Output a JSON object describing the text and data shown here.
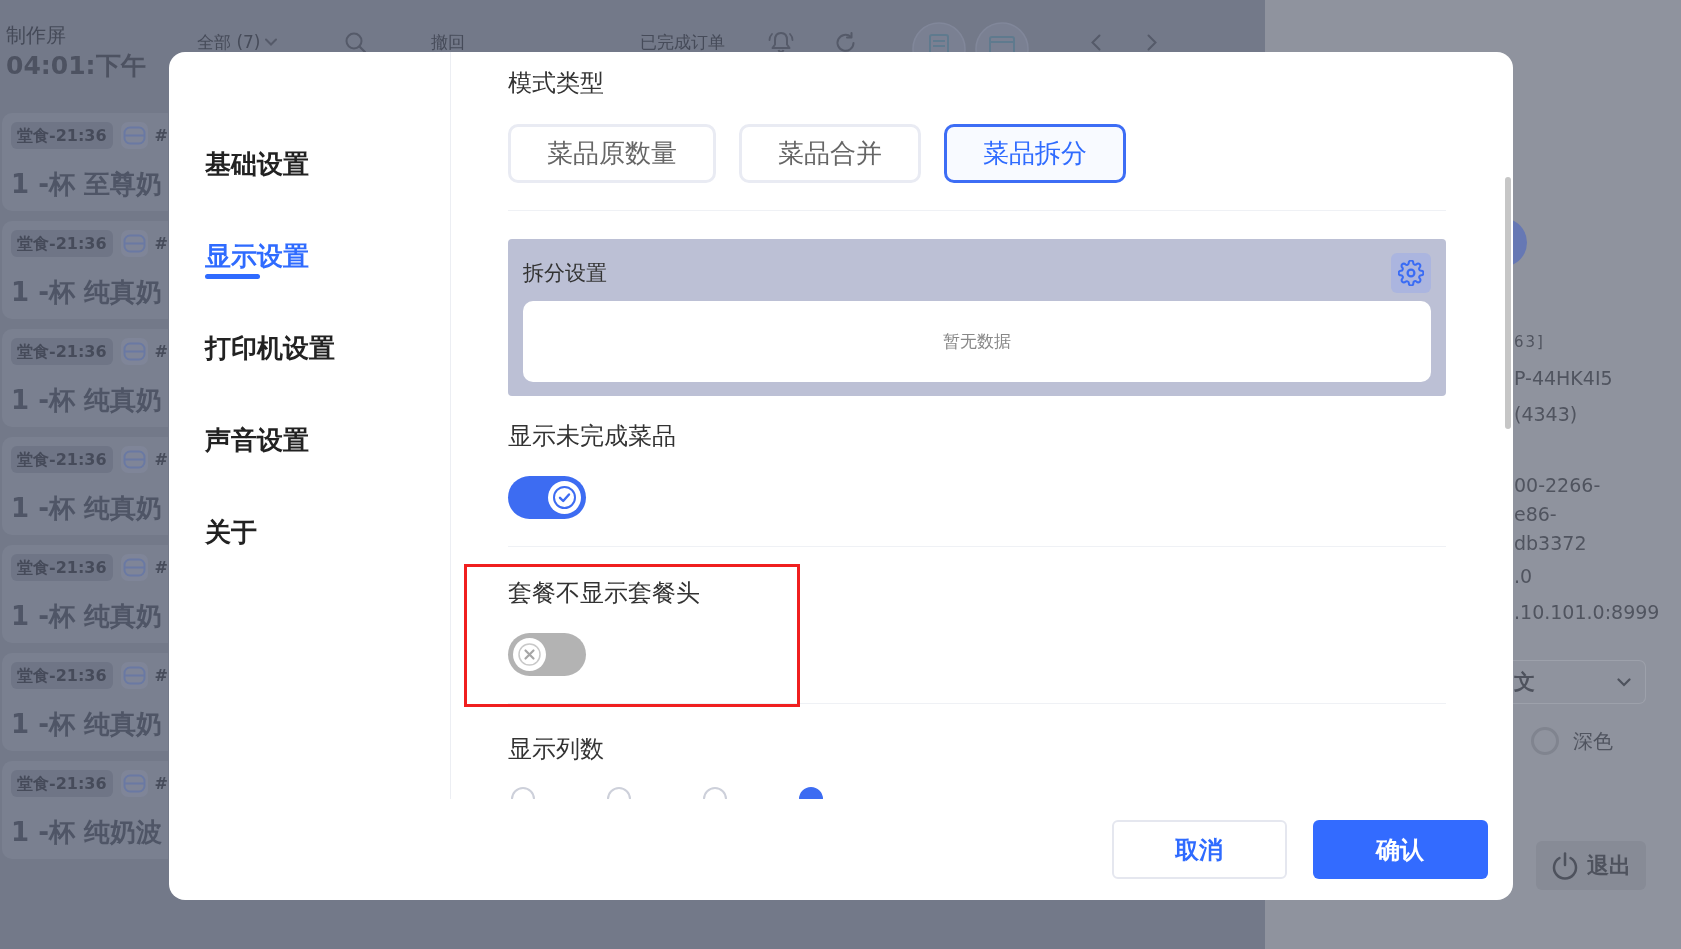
{
  "header": {
    "title": "制作屏",
    "time": "04:01:下午",
    "filter": "全部 (7)",
    "actions": [
      "撤回",
      "已完成订单"
    ]
  },
  "orders": [
    {
      "tag": "堂食-21:36",
      "number": "#",
      "item": "1 -杯 至尊奶"
    },
    {
      "tag": "堂食-21:36",
      "number": "#",
      "item": "1 -杯 纯真奶"
    },
    {
      "tag": "堂食-21:36",
      "number": "#",
      "item": "1 -杯 纯真奶"
    },
    {
      "tag": "堂食-21:36",
      "number": "#",
      "item": "1 -杯 纯真奶"
    },
    {
      "tag": "堂食-21:36",
      "number": "#",
      "item": "1 -杯 纯真奶"
    },
    {
      "tag": "堂食-21:36",
      "number": "#",
      "item": "1 -杯 纯真奶"
    },
    {
      "tag": "堂食-21:36",
      "number": "#",
      "item": "1 -杯 纯奶波"
    }
  ],
  "side_panel": {
    "info": [
      {
        "lines": [
          "63]"
        ]
      },
      {
        "lines": [
          "P-44HK4I5"
        ]
      },
      {
        "lines": [
          "(4343)"
        ]
      },
      {
        "lines": [
          "00-2266-",
          "e86-",
          "db3372"
        ]
      },
      {
        "lines": [
          ".0"
        ]
      },
      {
        "lines": [
          ".10.101.0:8999"
        ]
      }
    ],
    "language": "文",
    "theme_options": [
      {
        "label": "深色",
        "selected": false
      }
    ],
    "logout": "退出"
  },
  "dialog": {
    "nav": [
      {
        "label": "基础设置",
        "selected": false
      },
      {
        "label": "显示设置",
        "selected": true
      },
      {
        "label": "打印机设置",
        "selected": false
      },
      {
        "label": "声音设置",
        "selected": false
      },
      {
        "label": "关于",
        "selected": false
      }
    ],
    "sections": [
      {
        "kind": "segmented",
        "label": "模式类型",
        "highlighted": false,
        "options": [
          {
            "label": "菜品原数量",
            "selected": false
          },
          {
            "label": "菜品合并",
            "selected": false
          },
          {
            "label": "菜品拆分",
            "selected": true
          }
        ]
      },
      {
        "kind": "panel",
        "title": "拆分设置",
        "empty_text": "暂无数据",
        "highlighted": false
      },
      {
        "kind": "toggle",
        "label": "显示未完成菜品",
        "on": true,
        "highlighted": false
      },
      {
        "kind": "toggle",
        "label": "套餐不显示套餐头",
        "on": false,
        "highlighted": true
      },
      {
        "kind": "radio",
        "label": "显示列数",
        "highlighted": false,
        "options": [
          {
            "selected": false
          },
          {
            "selected": false
          },
          {
            "selected": false
          },
          {
            "selected": true
          }
        ]
      }
    ],
    "buttons": [
      {
        "label": "取消",
        "kind": "secondary"
      },
      {
        "label": "确认",
        "kind": "primary"
      }
    ]
  }
}
